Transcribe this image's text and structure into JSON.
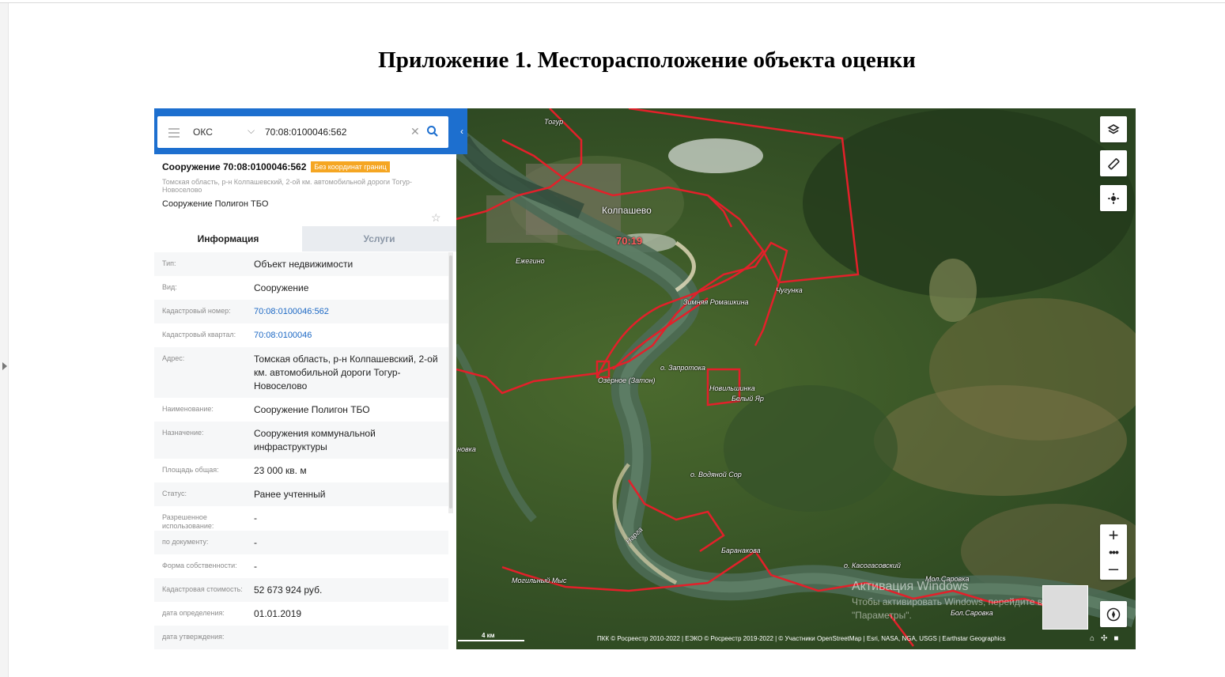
{
  "document": {
    "title": "Приложение 1. Месторасположение объекта оценки"
  },
  "search": {
    "type_value": "ОКС",
    "query": "70:08:0100046:562"
  },
  "object": {
    "heading": "Сооружение 70:08:0100046:562",
    "badge": "Без координат границ",
    "address": "Томская область, р-н Колпашевский, 2-ой км. автомобильной дороги Тогур-Новоселово",
    "name": "Сооружение Полигон ТБО"
  },
  "tabs": [
    {
      "label": "Информация",
      "active": true
    },
    {
      "label": "Услуги",
      "active": false
    }
  ],
  "info_rows": [
    {
      "key": "Тип:",
      "value": "Объект недвижимости"
    },
    {
      "key": "Вид:",
      "value": "Сооружение"
    },
    {
      "key": "Кадастровый номер:",
      "value": "70:08:0100046:562",
      "link": true
    },
    {
      "key": "Кадастровый квартал:",
      "value": "70:08:0100046",
      "link": true
    },
    {
      "key": "Адрес:",
      "value": "Томская область, р-н Колпашевский, 2-ой км. автомобильной дороги Тогур-Новоселово"
    },
    {
      "key": "Наименование:",
      "value": "Сооружение Полигон ТБО"
    },
    {
      "key": "Назначение:",
      "value": "Сооружения коммунальной инфраструктуры"
    },
    {
      "key": "Площадь общая:",
      "value": "23 000 кв. м"
    },
    {
      "key": "Статус:",
      "value": "Ранее учтенный"
    },
    {
      "key": "Разрешенное использование:",
      "value": "-"
    },
    {
      "key": "по документу:",
      "value": "-"
    },
    {
      "key": "Форма собственности:",
      "value": "-"
    },
    {
      "key": "Кадастровая стоимость:",
      "value": "52 673 924 руб."
    },
    {
      "key": "дата определения:",
      "value": "01.01.2019"
    },
    {
      "key": "дата утверждения:",
      "value": ""
    }
  ],
  "map": {
    "labels": {
      "togur": "Тогур",
      "kolpashevo": "Колпашево",
      "parcel": "70:19",
      "ezhegino": "Ежегино",
      "zimnyaya": "Зимняя Ромашкина",
      "chugunka": "Чугунка",
      "zaprotoka": "о. Запротока",
      "ozernoe": "Озёрное (Затон)",
      "novilshinka": "Новильшинка",
      "bely_yar": "Белый Яр",
      "novka": "новка",
      "vodyanoy": "о. Водяной Сор",
      "narga": "Нарга",
      "baranakovo": "Баранакова",
      "kasogasovsky": "о. Касогасовский",
      "mol_sarovka": "Мол.Саровка",
      "bol_sarovka": "Бол.Саровка",
      "mogilny": "Могильный Мыс"
    },
    "scale": "4 км",
    "attribution": "ПКК © Росреестр 2010-2022 | ЕЭКО © Росреестр 2019-2022 | © Участники OpenStreetMap | Esri, NASA, NGA, USGS | Earthstar Geographics",
    "watermark_title": "Активация Windows",
    "watermark_line1": "Чтобы активировать Windows, перейдите в раздел",
    "watermark_line2": "\"Параметры\".",
    "zoom_in": "+",
    "zoom_out": "–",
    "more": "•••",
    "boundary_color": "#e3202a",
    "accent_color": "#1d6fcf"
  }
}
